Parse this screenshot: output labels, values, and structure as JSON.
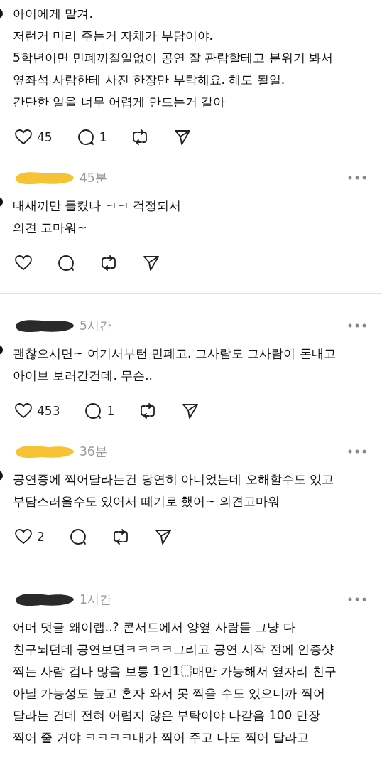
{
  "threads": [
    {
      "comments": [
        {
          "avatar": true,
          "body": "아이에게 맡겨.\n저런거 미리 주는거 자체가 부담이야.\n5학년이면 민폐끼칠일없이 공연 잘 관람할테고 분위기 봐서\n옆좌석 사람한테 사진 한장만 부탁해요. 해도 될일.\n간단한 일을 너무 어렵게 만드는거 같아",
          "likes": "45",
          "replies": "1"
        },
        {
          "avatar": true,
          "color": "#f8c235",
          "time": "45분",
          "body": "내새끼만 들켰나 ㅋㅋ 걱정되서\n의견 고마워~"
        }
      ]
    },
    {
      "comments": [
        {
          "avatar": true,
          "color": "#2a2a2a",
          "time": "5시간",
          "body": "괜찮으시면~ 여기서부턴 민폐고. 그사람도 그사람이 돈내고\n아이브 보러간건데. 무슨..",
          "likes": "453",
          "replies": "1"
        },
        {
          "avatar": true,
          "color": "#f8c235",
          "time": "36분",
          "body": "공연중에 찍어달라는건 당연히 아니었는데 오해할수도 있고\n부담스러울수도 있어서 떼기로 했어~ 의견고마워",
          "likes": "2"
        }
      ]
    },
    {
      "comments": [
        {
          "avatar": false,
          "color": "#2a2a2a",
          "time": "1시간",
          "body_parts": [
            "어머 댓글 왜이랩..? 콘서트에서 양옆 사람들 그냥 다\n친구되던데 공연보면ㅋㅋㅋㅋ그리고 공연 시작 전에 인증샷\n찍는 사람 겁나 많음 보통 1인1",
            "매만 가능해서 옆자리 친구\n아닐 가능성도 높고 혼자 와서 못 찍을 수도 있으니까 찍어\n달라는 건데 전혀 어렵지 않은 부탁이야 나같음 100 만장\n찍어 줄 거야 ㅋㅋㅋㅋ내가 찍어 주고 나도 찍어 달라고"
          ],
          "no_actions": true
        }
      ]
    }
  ]
}
